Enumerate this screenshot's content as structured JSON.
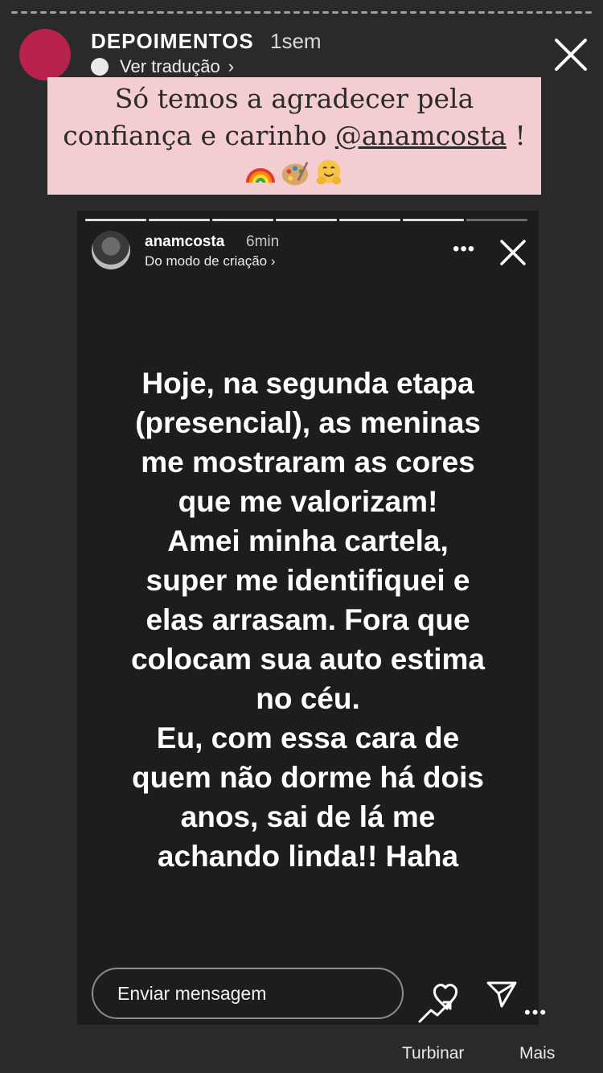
{
  "outer_story": {
    "username": "DEPOIMENTOS",
    "time": "1sem",
    "translate_label": "Ver tradução",
    "caption_line1": "Só temos a agradecer pela",
    "caption_line2_prefix": "confiança e carinho ",
    "caption_mention": "@anamcosta",
    "caption_line2_suffix": " !",
    "caption_emojis": [
      "rainbow-emoji",
      "artist-palette-emoji",
      "hugging-face-emoji"
    ]
  },
  "inner_story": {
    "username": "anamcosta",
    "time": "6min",
    "subtitle": "Do modo de criação ›",
    "more_label": "•••",
    "progress_total": 7,
    "progress_current": 6,
    "text_lines": [
      "Hoje, na segunda etapa",
      "(presencial), as meninas",
      "me mostraram as cores",
      "que me valorizam!",
      "Amei minha cartela,",
      "super me identifiquei e",
      "elas arrasam. Fora que",
      "colocam sua auto estima",
      "no céu.",
      "Eu, com essa cara de",
      "quem não dorme há dois",
      "anos, sai de lá me",
      "achando linda!! Haha"
    ]
  },
  "footer": {
    "message_placeholder": "Enviar mensagem",
    "boost_label": "Turbinar",
    "more_label": "Mais",
    "more_dots": "•••"
  },
  "colors": {
    "background": "#2a2a2a",
    "caption_bg": "#f4cdd1",
    "avatar": "#b8234d"
  }
}
